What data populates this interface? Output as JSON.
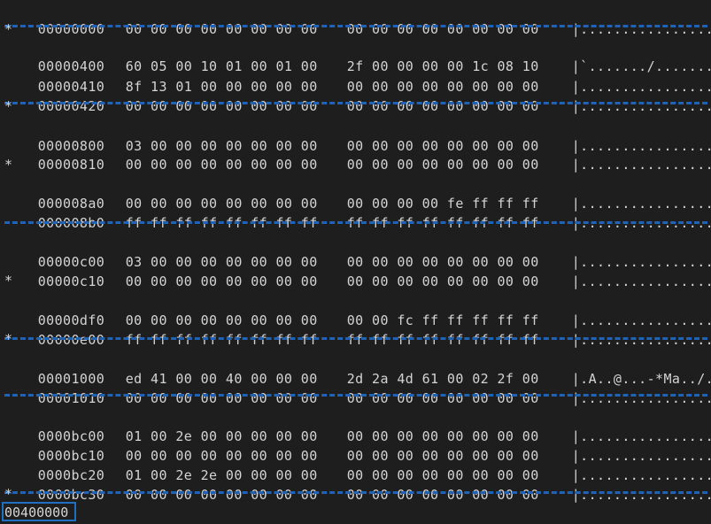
{
  "colors": {
    "background": "#1e1e1e",
    "text": "#d4d4d4",
    "separator": "#1f63b8",
    "cursor_border": "#1f6fc4"
  },
  "hexdump": {
    "rows": [
      {
        "addr": "00000000",
        "b1": "00 00 00 00 00 00 00 00",
        "b2": "00 00 00 00 00 00 00 00",
        "ascii": "|................|"
      },
      {
        "addr": "00000400",
        "b1": "60 05 00 10 01 00 01 00",
        "b2": "2f 00 00 00 00 1c 08 10",
        "ascii": "|`......./.......|"
      },
      {
        "addr": "00000410",
        "b1": "8f 13 01 00 00 00 00 00",
        "b2": "00 00 00 00 00 00 00 00",
        "ascii": "|................|"
      },
      {
        "addr": "00000420",
        "b1": "00 00 00 00 00 00 00 00",
        "b2": "00 00 00 00 00 00 00 00",
        "ascii": "|................|"
      },
      {
        "addr": "00000800",
        "b1": "03 00 00 00 00 00 00 00",
        "b2": "00 00 00 00 00 00 00 00",
        "ascii": "|................|"
      },
      {
        "addr": "00000810",
        "b1": "00 00 00 00 00 00 00 00",
        "b2": "00 00 00 00 00 00 00 00",
        "ascii": "|................|"
      },
      {
        "addr": "000008a0",
        "b1": "00 00 00 00 00 00 00 00",
        "b2": "00 00 00 00 fe ff ff ff",
        "ascii": "|................|"
      },
      {
        "addr": "000008b0",
        "b1": "ff ff ff ff ff ff ff ff",
        "b2": "ff ff ff ff ff ff ff ff",
        "ascii": "|................|"
      },
      {
        "addr": "00000c00",
        "b1": "03 00 00 00 00 00 00 00",
        "b2": "00 00 00 00 00 00 00 00",
        "ascii": "|................|"
      },
      {
        "addr": "00000c10",
        "b1": "00 00 00 00 00 00 00 00",
        "b2": "00 00 00 00 00 00 00 00",
        "ascii": "|................|"
      },
      {
        "addr": "00000df0",
        "b1": "00 00 00 00 00 00 00 00",
        "b2": "00 00 fc ff ff ff ff ff",
        "ascii": "|................|"
      },
      {
        "addr": "00000e00",
        "b1": "ff ff ff ff ff ff ff ff",
        "b2": "ff ff ff ff ff ff ff ff",
        "ascii": "|................|"
      },
      {
        "addr": "00001000",
        "b1": "ed 41 00 00 40 00 00 00",
        "b2": "2d 2a 4d 61 00 02 2f 00",
        "ascii": "|.A..@...-*Ma../.|"
      },
      {
        "addr": "00001010",
        "b1": "00 00 00 00 00 00 00 00",
        "b2": "00 00 00 00 00 00 00 00",
        "ascii": "|................|"
      },
      {
        "addr": "0000bc00",
        "b1": "01 00 2e 00 00 00 00 00",
        "b2": "00 00 00 00 00 00 00 00",
        "ascii": "|................|"
      },
      {
        "addr": "0000bc10",
        "b1": "00 00 00 00 00 00 00 00",
        "b2": "00 00 00 00 00 00 00 00",
        "ascii": "|................|"
      },
      {
        "addr": "0000bc20",
        "b1": "01 00 2e 2e 00 00 00 00",
        "b2": "00 00 00 00 00 00 00 00",
        "ascii": "|................|"
      },
      {
        "addr": "0000bc30",
        "b1": "00 00 00 00 00 00 00 00",
        "b2": "00 00 00 00 00 00 00 00",
        "ascii": "|................|"
      }
    ],
    "repeat_marker": "*",
    "final_offset": "00400000"
  }
}
